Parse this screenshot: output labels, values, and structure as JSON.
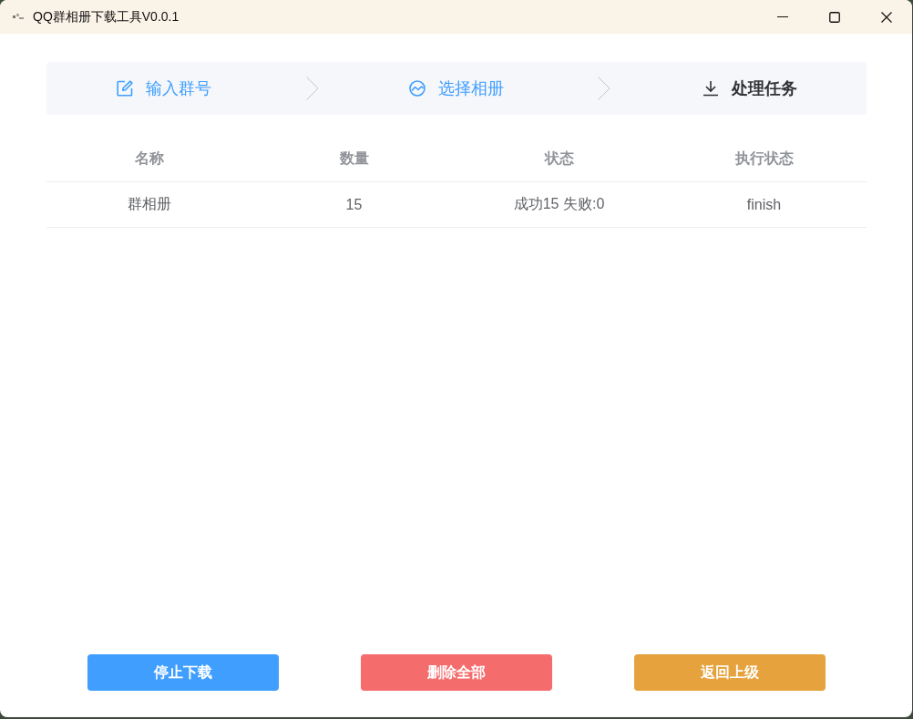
{
  "window": {
    "title": "QQ群相册下载工具V0.0.1"
  },
  "steps": [
    {
      "label": "输入群号",
      "selected": false
    },
    {
      "label": "选择相册",
      "selected": false
    },
    {
      "label": "处理任务",
      "selected": true
    }
  ],
  "table": {
    "columns": [
      "名称",
      "数量",
      "状态",
      "执行状态"
    ],
    "rows": [
      [
        "群相册",
        "15",
        "成功15 失败:0",
        "finish"
      ]
    ]
  },
  "buttons": [
    {
      "label": "停止下载",
      "kind": "primary"
    },
    {
      "label": "删除全部",
      "kind": "danger"
    },
    {
      "label": "返回上级",
      "kind": "warning"
    }
  ]
}
